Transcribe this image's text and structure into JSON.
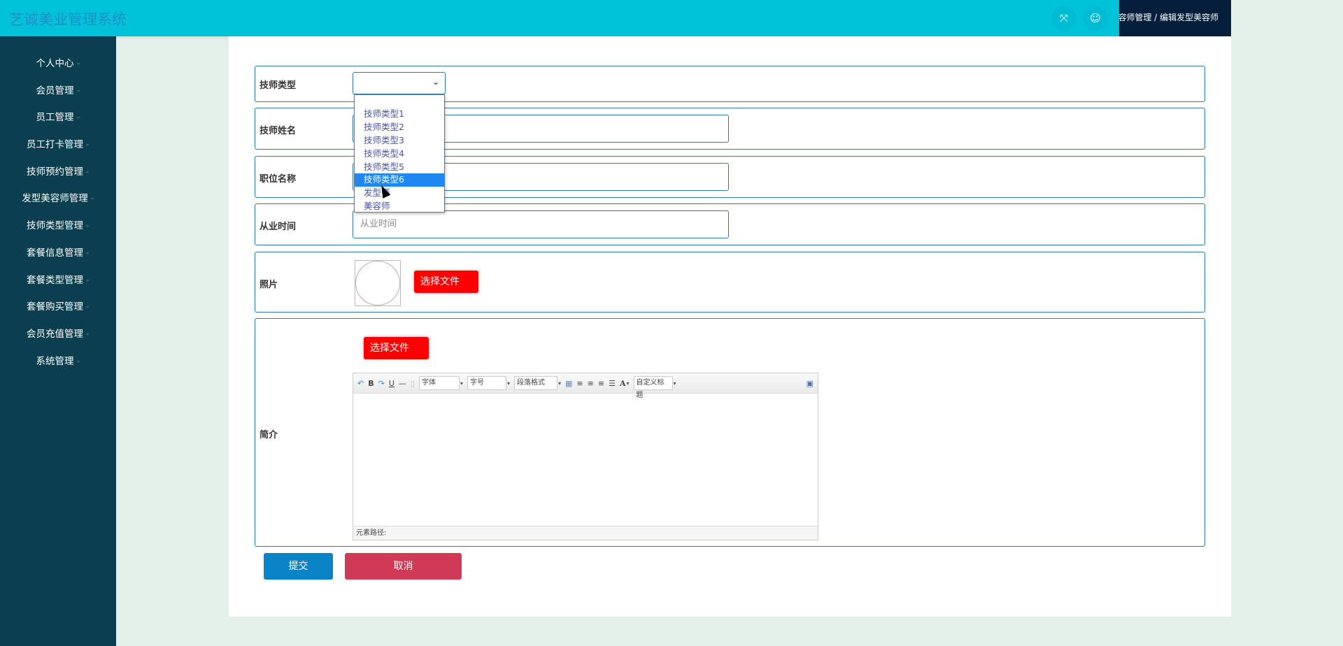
{
  "header": {
    "title": "艺诚美业管理系统",
    "breadcrumb": "发型美容师管理 / 编辑发型美容师",
    "icons": [
      "fullscreen-icon",
      "user-icon"
    ]
  },
  "sidebar": {
    "items": [
      {
        "label": "个人中心"
      },
      {
        "label": "会员管理"
      },
      {
        "label": "员工管理"
      },
      {
        "label": "员工打卡管理"
      },
      {
        "label": "技师预约管理"
      },
      {
        "label": "发型美容师管理"
      },
      {
        "label": "技师类型管理"
      },
      {
        "label": "套餐信息管理"
      },
      {
        "label": "套餐类型管理"
      },
      {
        "label": "套餐购买管理"
      },
      {
        "label": "会员充值管理"
      },
      {
        "label": "系统管理"
      }
    ]
  },
  "form": {
    "type_label": "技师类型",
    "type_value": "",
    "type_options": [
      "",
      "技师类型1",
      "技师类型2",
      "技师类型3",
      "技师类型4",
      "技师类型5",
      "技师类型6",
      "发型师",
      "美容师"
    ],
    "type_highlighted": "技师类型6",
    "name_label": "技师姓名",
    "name_value": "",
    "position_label": "职位名称",
    "position_value": "",
    "years_label": "从业时间",
    "years_placeholder": "从业时间",
    "photo_label": "照片",
    "photo_button": "选择文件",
    "intro_label": "简介",
    "intro_button": "选择文件",
    "editor": {
      "font": "字体",
      "size": "字号",
      "paragraph": "段落格式",
      "custom_title": "自定义标题",
      "path_label": "元素路径:"
    },
    "submit": "提交",
    "cancel": "取消"
  },
  "colors": {
    "header": "#00c3d9",
    "sidebar": "#0b3f4f",
    "border": "#2b7bb0",
    "submit": "#0a84c6",
    "cancel": "#d13a56",
    "file_button": "#ff0000"
  }
}
